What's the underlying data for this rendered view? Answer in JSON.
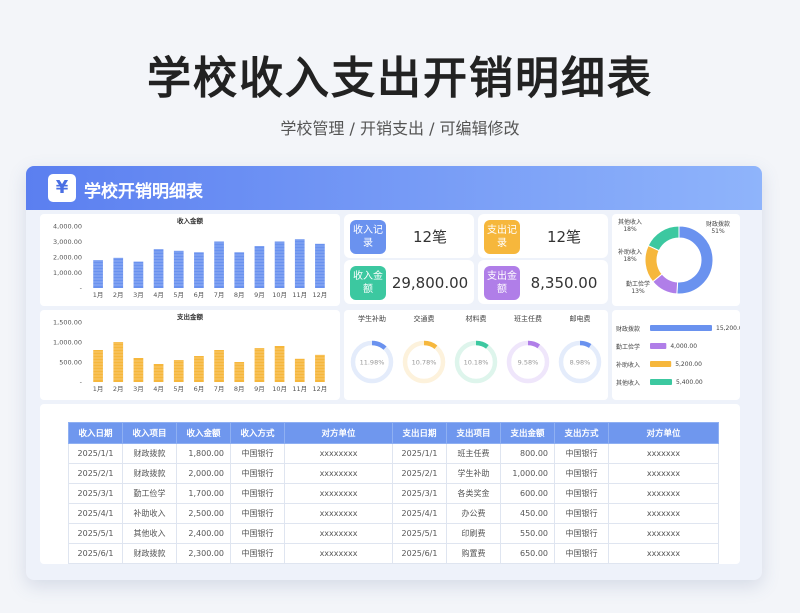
{
  "title": "学校收入支出开销明细表",
  "subtitle": "学校管理 / 开销支出 /  可编辑修改",
  "card": {
    "logo": "¥",
    "title": "学校开销明细表"
  },
  "charts": [
    {
      "type": "bar",
      "title": "收入金额",
      "categories": [
        "1月",
        "2月",
        "3月",
        "4月",
        "5月",
        "6月",
        "7月",
        "8月",
        "9月",
        "10月",
        "11月",
        "12月"
      ],
      "values": [
        1800,
        1950,
        1700,
        2500,
        2400,
        2300,
        3000,
        2300,
        2700,
        3000,
        3150,
        2850
      ],
      "ylim": [
        0,
        4000
      ],
      "yticks": [
        "4,000.00",
        "3,000.00",
        "2,000.00",
        "1,000.00",
        "-"
      ],
      "color": "#6a92ef"
    },
    {
      "type": "bar",
      "title": "支出金额",
      "categories": [
        "1月",
        "2月",
        "3月",
        "4月",
        "5月",
        "6月",
        "7月",
        "8月",
        "9月",
        "10月",
        "11月",
        "12月"
      ],
      "values": [
        800,
        1000,
        600,
        450,
        550,
        650,
        800,
        500,
        850,
        900,
        580,
        680
      ],
      "ylim": [
        0,
        1500
      ],
      "yticks": [
        "1,500.00",
        "1,000.00",
        "500.00",
        "-"
      ],
      "color": "#f6b73c"
    },
    {
      "type": "pie",
      "slices": [
        {
          "label": "财政拨款",
          "pct": "51%",
          "value": 51,
          "color": "#6a92ef"
        },
        {
          "label": "勤工俭学",
          "pct": "13%",
          "value": 13,
          "color": "#b07ee8"
        },
        {
          "label": "补助收入",
          "pct": "18%",
          "value": 18,
          "color": "#f6b73c"
        },
        {
          "label": "其他收入",
          "pct": "18%",
          "value": 18,
          "color": "#3cc8a0"
        }
      ]
    },
    {
      "type": "bar",
      "orientation": "horizontal",
      "categories": [
        "财政拨款",
        "勤工俭学",
        "补助收入",
        "其他收入"
      ],
      "value_labels": [
        "15,200.00",
        "4,000.00",
        "5,200.00",
        "5,400.00"
      ],
      "values": [
        15200,
        4000,
        5200,
        5400
      ],
      "colors": [
        "#6a92ef",
        "#b07ee8",
        "#f6b73c",
        "#3cc8a0"
      ]
    }
  ],
  "stats": [
    {
      "label": "收入记录",
      "value": "12笔",
      "color": "#6a92ef"
    },
    {
      "label": "支出记录",
      "value": "12笔",
      "color": "#f6b73c"
    },
    {
      "label": "收入金额",
      "value": "29,800.00",
      "color": "#3cc8a0"
    },
    {
      "label": "支出金额",
      "value": "8,350.00",
      "color": "#b07ee8"
    }
  ],
  "rings": [
    {
      "label": "学生补助",
      "pct": "11.98%",
      "value": 11.98,
      "color": "#6a92ef",
      "bg": "#e4ecfb"
    },
    {
      "label": "交通费",
      "pct": "10.78%",
      "value": 10.78,
      "color": "#f6b73c",
      "bg": "#fdf2dc"
    },
    {
      "label": "材料费",
      "pct": "10.18%",
      "value": 10.18,
      "color": "#3cc8a0",
      "bg": "#def5ec"
    },
    {
      "label": "班主任费",
      "pct": "9.58%",
      "value": 9.58,
      "color": "#b07ee8",
      "bg": "#efe6fb"
    },
    {
      "label": "邮电费",
      "pct": "8.98%",
      "value": 8.98,
      "color": "#6a92ef",
      "bg": "#e4ecfb"
    }
  ],
  "table": {
    "income_headers": [
      "收入日期",
      "收入项目",
      "收入金额",
      "收入方式",
      "对方单位"
    ],
    "expense_headers": [
      "支出日期",
      "支出项目",
      "支出金额",
      "支出方式",
      "对方单位"
    ],
    "income_rows": [
      [
        "2025/1/1",
        "财政拨款",
        "1,800.00",
        "中国银行",
        "xxxxxxxx"
      ],
      [
        "2025/2/1",
        "财政拨款",
        "2,000.00",
        "中国银行",
        "xxxxxxxx"
      ],
      [
        "2025/3/1",
        "勤工俭学",
        "1,700.00",
        "中国银行",
        "xxxxxxxx"
      ],
      [
        "2025/4/1",
        "补助收入",
        "2,500.00",
        "中国银行",
        "xxxxxxxx"
      ],
      [
        "2025/5/1",
        "其他收入",
        "2,400.00",
        "中国银行",
        "xxxxxxxx"
      ],
      [
        "2025/6/1",
        "财政拨款",
        "2,300.00",
        "中国银行",
        "xxxxxxxx"
      ]
    ],
    "expense_rows": [
      [
        "2025/1/1",
        "班主任费",
        "800.00",
        "中国银行",
        "xxxxxxx"
      ],
      [
        "2025/2/1",
        "学生补助",
        "1,000.00",
        "中国银行",
        "xxxxxxx"
      ],
      [
        "2025/3/1",
        "各类奖金",
        "600.00",
        "中国银行",
        "xxxxxxx"
      ],
      [
        "2025/4/1",
        "办公费",
        "450.00",
        "中国银行",
        "xxxxxxx"
      ],
      [
        "2025/5/1",
        "印刷费",
        "550.00",
        "中国银行",
        "xxxxxxx"
      ],
      [
        "2025/6/1",
        "购置费",
        "650.00",
        "中国银行",
        "xxxxxxx"
      ]
    ]
  }
}
